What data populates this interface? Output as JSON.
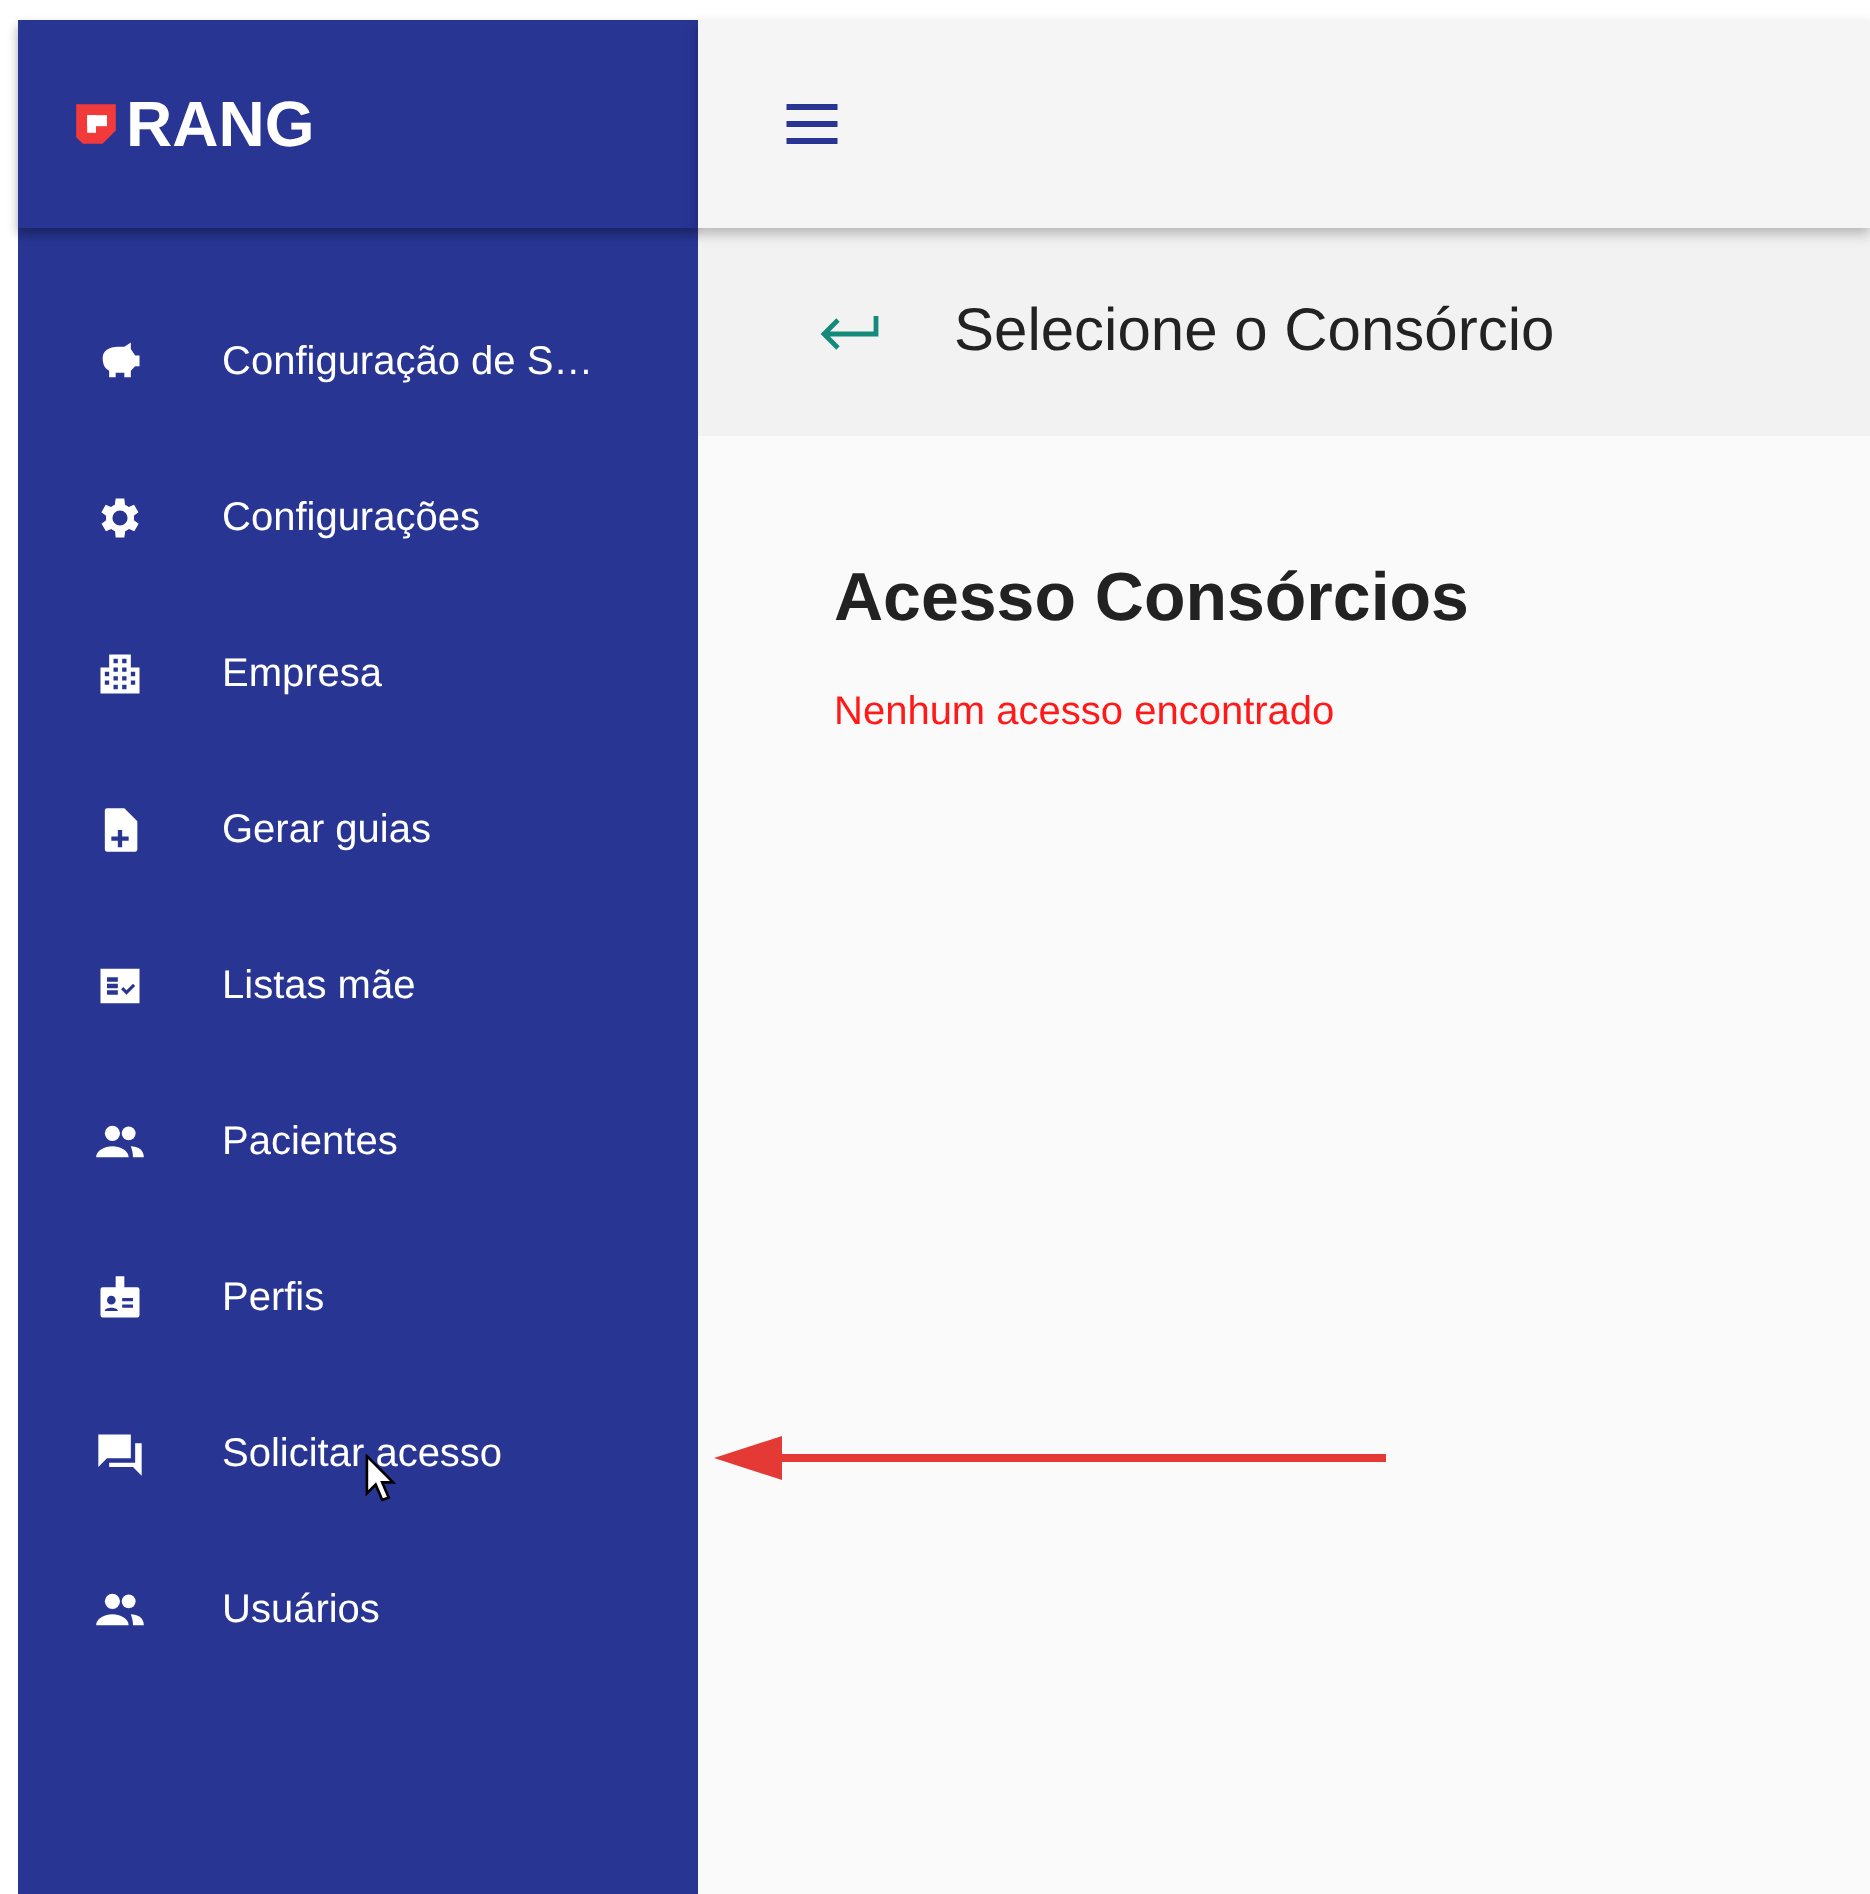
{
  "logo": {
    "text": "RANG"
  },
  "sidebar": {
    "items": [
      {
        "label": "Configuração de S…"
      },
      {
        "label": "Configurações"
      },
      {
        "label": "Empresa"
      },
      {
        "label": "Gerar guias"
      },
      {
        "label": "Listas mãe"
      },
      {
        "label": "Pacientes"
      },
      {
        "label": "Perfis"
      },
      {
        "label": "Solicitar acesso"
      },
      {
        "label": "Usuários"
      }
    ]
  },
  "subheader": {
    "title": "Selecione o Consórcio"
  },
  "content": {
    "heading": "Acesso Consórcios",
    "message": "Nenhum acesso encontrado"
  }
}
